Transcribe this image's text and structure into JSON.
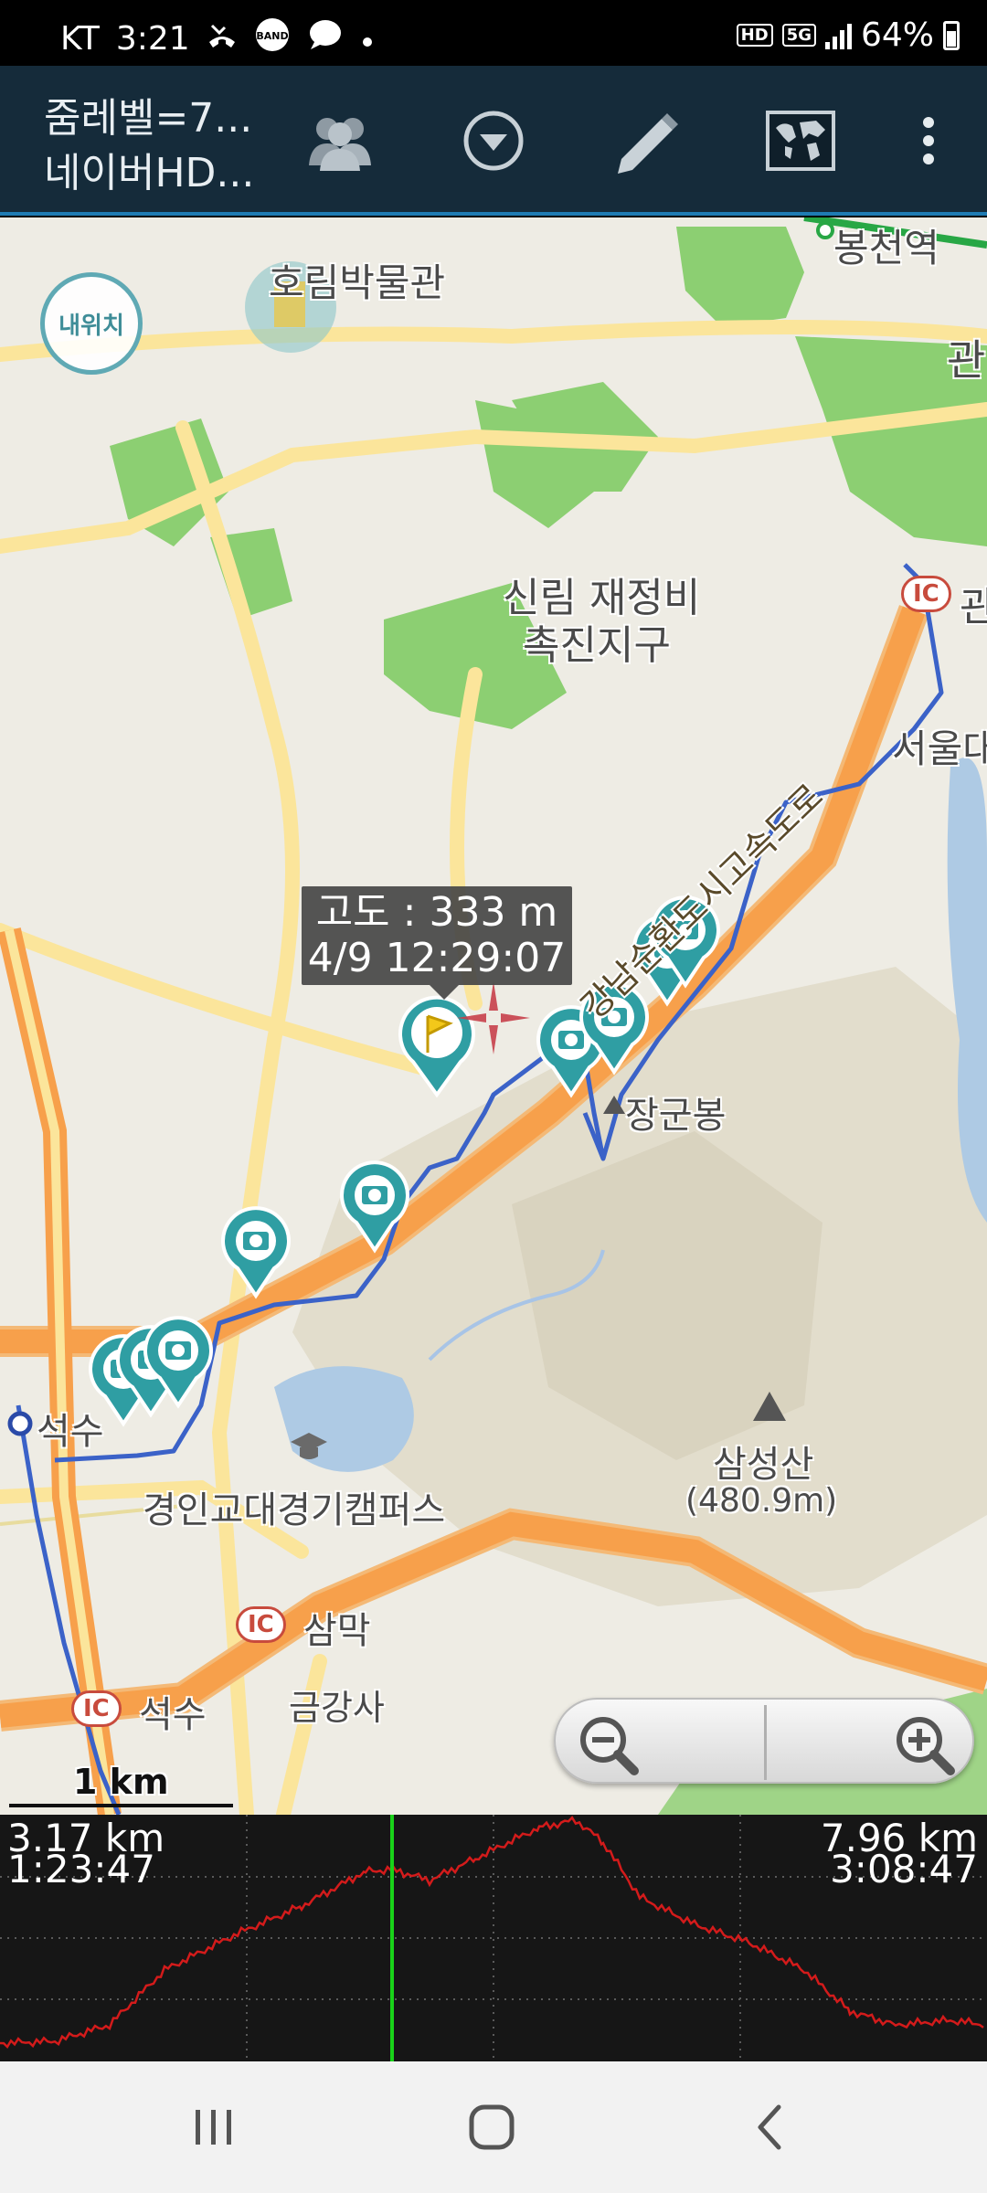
{
  "status_bar": {
    "carrier": "KT",
    "time": "3:21",
    "band_label": "BAND",
    "hd_label": "HD",
    "network_label": "5G",
    "battery_text": "64%",
    "battery_level_percent": 64
  },
  "app_header": {
    "title_line1": "줌레벨=7...",
    "title_line2": "네이버HD...",
    "icons": [
      "group-icon",
      "dropdown-circle-icon",
      "pencil-icon",
      "world-map-icon",
      "more-vert-icon"
    ]
  },
  "map": {
    "my_location_button": "내위치",
    "tooltip": {
      "altitude": "고도 : 333 m",
      "timestamp": "4/9 12:29:07"
    },
    "labels": {
      "museum": "호림박물관",
      "station_top": "봉천역",
      "right_edge_top": "관",
      "redevelopment_line1": "신림 재정비",
      "redevelopment_line2": "촉진지구",
      "ic_right": "관",
      "seoul_univ": "서울대",
      "expressway": "강남순환도시고속도로",
      "peak_janggun": "장군봉",
      "peak_samseong": "삼성산",
      "peak_samseong_alt": "(480.9m)",
      "campus": "경인교대경기캠퍼스",
      "seoksu_left": "석수",
      "ic_sammak": "삼막",
      "ic_seoksu": "석수",
      "geumgangsa": "금강사",
      "ic_badge": "IC"
    },
    "scale_label": "1 km",
    "colors": {
      "track": "#3b62c8",
      "marker": "#2f9ea3",
      "road_major": "#f7a04b",
      "road_minor": "#fbe59b",
      "park": "#8ccf72"
    }
  },
  "profile": {
    "left_distance": "3.17 km",
    "left_time": "1:23:47",
    "right_distance": "7.96 km",
    "right_time": "3:08:47",
    "line_color": "#d31b1b",
    "cursor_color": "#19d219"
  },
  "nav_bar": {
    "icons": [
      "recent-apps-icon",
      "home-icon",
      "back-icon"
    ]
  }
}
